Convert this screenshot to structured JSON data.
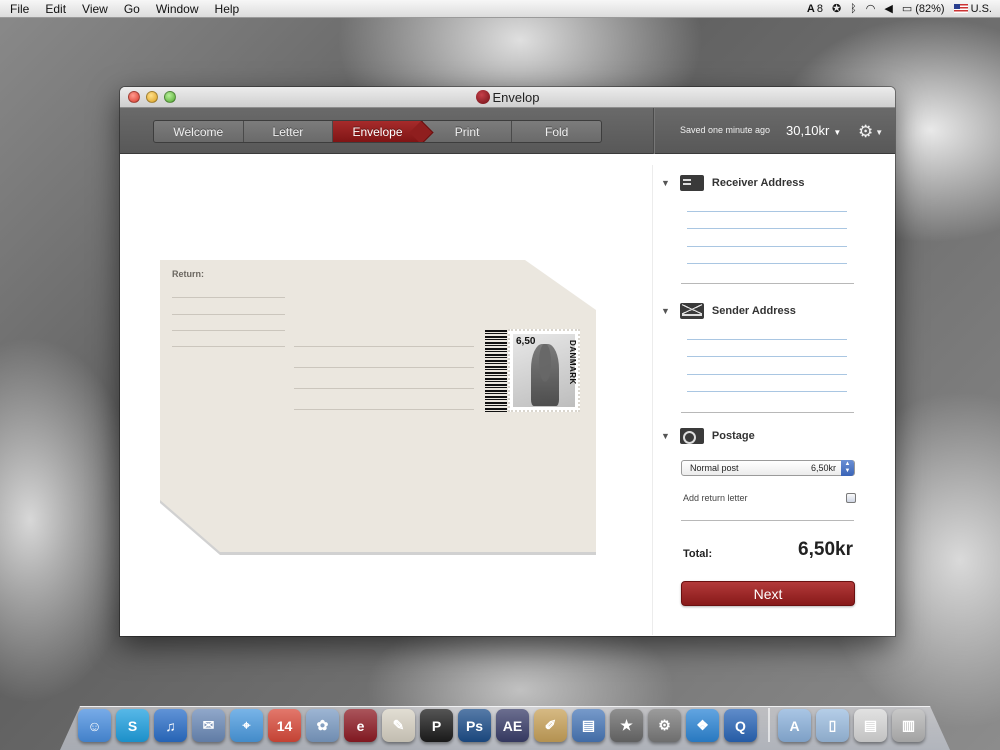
{
  "menubar": {
    "items": [
      "File",
      "Edit",
      "View",
      "Go",
      "Window",
      "Help"
    ],
    "status": {
      "adobe_badge": "8",
      "battery": "(82%)",
      "input_source": "U.S."
    }
  },
  "window": {
    "title": "Envelop",
    "steps": [
      "Welcome",
      "Letter",
      "Envelope",
      "Print",
      "Fold"
    ],
    "active_step": "Envelope",
    "saved_status": "Saved one minute ago",
    "balance": "30,10kr"
  },
  "envelope": {
    "return_label": "Return:",
    "stamp_value": "6,50",
    "stamp_country": "DANMARK"
  },
  "sidebar": {
    "receiver_title": "Receiver Address",
    "sender_title": "Sender Address",
    "postage_title": "Postage",
    "postage_option": "Normal post",
    "postage_price": "6,50kr",
    "return_letter_label": "Add return letter",
    "total_label": "Total:",
    "total_value": "6,50kr",
    "next_label": "Next"
  },
  "dock": {
    "apps": [
      {
        "name": "finder-icon",
        "glyph": "☺",
        "color": "#4a8fe0"
      },
      {
        "name": "skype-icon",
        "glyph": "S",
        "color": "#1fa0e0"
      },
      {
        "name": "itunes-icon",
        "glyph": "♫",
        "color": "#2b6fc9"
      },
      {
        "name": "mail-icon",
        "glyph": "✉",
        "color": "#6b8ab8"
      },
      {
        "name": "safari-icon",
        "glyph": "⌖",
        "color": "#4b9be0"
      },
      {
        "name": "ical-icon",
        "glyph": "14",
        "color": "#d94a3a"
      },
      {
        "name": "iphoto-icon",
        "glyph": "✿",
        "color": "#7c9cc4"
      },
      {
        "name": "envelop-icon",
        "glyph": "e",
        "color": "#8e1b24"
      },
      {
        "name": "textedit-icon",
        "glyph": "✎",
        "color": "#d8d2c4"
      },
      {
        "name": "p-app-icon",
        "glyph": "P",
        "color": "#1c1c1c"
      },
      {
        "name": "photoshop-icon",
        "glyph": "Ps",
        "color": "#1d4e8a"
      },
      {
        "name": "aftereffects-icon",
        "glyph": "AE",
        "color": "#3a3e6a"
      },
      {
        "name": "pencil-icon",
        "glyph": "✐",
        "color": "#c8a25a"
      },
      {
        "name": "keynote-icon",
        "glyph": "▤",
        "color": "#4978b8"
      },
      {
        "name": "imovie-icon",
        "glyph": "★",
        "color": "#6a6a6a"
      },
      {
        "name": "system-preferences-icon",
        "glyph": "⚙",
        "color": "#7a7a7a"
      },
      {
        "name": "dropbox-icon",
        "glyph": "❖",
        "color": "#2d86d6"
      },
      {
        "name": "quicktime-icon",
        "glyph": "Q",
        "color": "#2a66b8"
      }
    ],
    "stacks": [
      {
        "name": "applications-folder-icon",
        "glyph": "A",
        "color": "#8cb2dc"
      },
      {
        "name": "documents-folder-icon",
        "glyph": "▯",
        "color": "#9cbde0"
      },
      {
        "name": "downloads-stack-icon",
        "glyph": "▤",
        "color": "#d8d8d8"
      },
      {
        "name": "trash-icon",
        "glyph": "▥",
        "color": "#b5b5b5"
      }
    ]
  }
}
